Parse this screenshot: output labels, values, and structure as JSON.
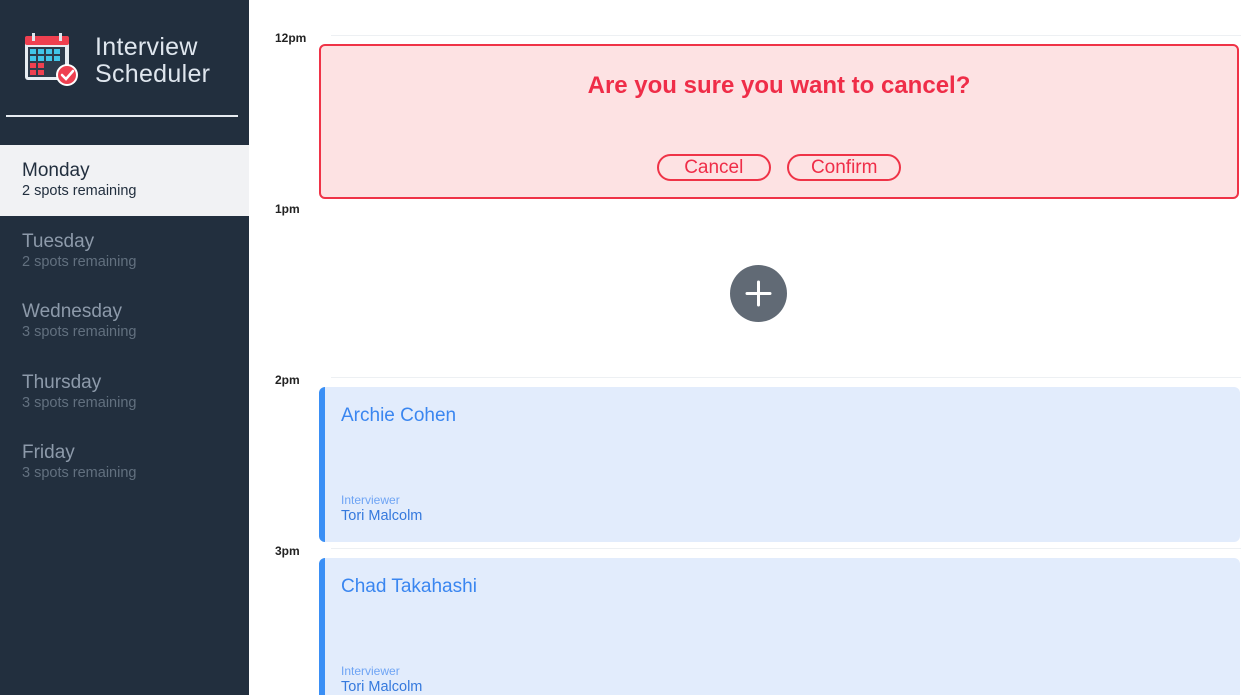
{
  "app": {
    "title_line1": "Interview",
    "title_line2": "Scheduler",
    "logo_icon": "calendar-check-icon"
  },
  "days": [
    {
      "name": "Monday",
      "spots": "2 spots remaining",
      "selected": true
    },
    {
      "name": "Tuesday",
      "spots": "2 spots remaining",
      "selected": false
    },
    {
      "name": "Wednesday",
      "spots": "3 spots remaining",
      "selected": false
    },
    {
      "name": "Thursday",
      "spots": "3 spots remaining",
      "selected": false
    },
    {
      "name": "Friday",
      "spots": "3 spots remaining",
      "selected": false
    }
  ],
  "schedule": {
    "times": [
      "12pm",
      "1pm",
      "2pm",
      "3pm"
    ],
    "confirm": {
      "message": "Are you sure you want to cancel?",
      "cancel_label": "Cancel",
      "confirm_label": "Confirm"
    },
    "add_icon": "plus-icon",
    "appointments": [
      {
        "student": "Archie Cohen",
        "interviewer_label": "Interviewer",
        "interviewer": "Tori Malcolm"
      },
      {
        "student": "Chad Takahashi",
        "interviewer_label": "Interviewer",
        "interviewer": "Tori Malcolm"
      }
    ]
  },
  "colors": {
    "sidebar_bg": "#222f3e",
    "danger": "#ef3347",
    "danger_bg": "#fde2e3",
    "appointment_accent": "#3a8ff5",
    "appointment_bg": "#e2ecfc",
    "add_button": "#616a75"
  }
}
